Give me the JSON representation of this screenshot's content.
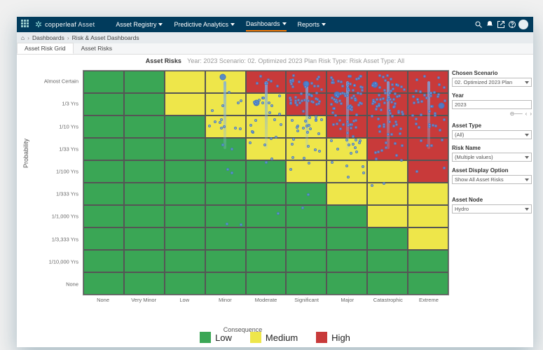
{
  "brand": {
    "name1": "copperleaf",
    "name2": "Asset"
  },
  "nav": {
    "items": [
      {
        "label": "Asset Registry"
      },
      {
        "label": "Predictive Analytics"
      },
      {
        "label": "Dashboards"
      },
      {
        "label": "Reports"
      }
    ],
    "active_index": 2
  },
  "breadcrumb": {
    "home": "⌂",
    "parts": [
      "Dashboards",
      "Risk & Asset Dashboards"
    ]
  },
  "subtabs": {
    "items": [
      "Asset Risk Grid",
      "Asset Risks"
    ],
    "active_index": 0
  },
  "chart_title": {
    "title": "Asset Risks",
    "meta": "Year: 2023   Scenario: 02. Optimized 2023 Plan   Risk Type: Risk   Asset Type: All"
  },
  "filters": {
    "scenario": {
      "label": "Chosen Scenario",
      "value": "02. Optimized 2023 Plan"
    },
    "year": {
      "label": "Year",
      "value": "2023"
    },
    "asset_type": {
      "label": "Asset Type",
      "value": "(All)"
    },
    "risk_name": {
      "label": "Risk Name",
      "value": "(Multiple values)"
    },
    "display": {
      "label": "Asset Display Option",
      "value": "Show All Asset Risks"
    },
    "node": {
      "label": "Asset Node",
      "value": "Hydro"
    }
  },
  "axes": {
    "xlabel": "Consequence",
    "ylabel": "Probability",
    "x_categories": [
      "None",
      "Very Minor",
      "Low",
      "Minor",
      "Moderate",
      "Significant",
      "Major",
      "Catastrophic",
      "Extreme"
    ],
    "y_categories": [
      "Almost Certain",
      "1/3 Yrs",
      "1/10 Yrs",
      "1/33 Yrs",
      "1/100 Yrs",
      "1/333 Yrs",
      "1/1,000 Yrs",
      "1/3,333 Yrs",
      "1/10,000 Yrs",
      "None"
    ]
  },
  "legend": {
    "low": "Low",
    "medium": "Medium",
    "high": "High"
  },
  "colors": {
    "low": "#3aa655",
    "medium": "#eee64a",
    "high": "#c83a3a",
    "navbg": "#013b5c",
    "accent": "#ff7a00"
  },
  "chart_data": {
    "type": "heatmap",
    "title": "Asset Risks",
    "xlabel": "Consequence",
    "ylabel": "Probability",
    "x_categories": [
      "None",
      "Very Minor",
      "Low",
      "Minor",
      "Moderate",
      "Significant",
      "Major",
      "Catastrophic",
      "Extreme"
    ],
    "y_categories_top_to_bottom": [
      "Almost Certain",
      "1/3 Yrs",
      "1/10 Yrs",
      "1/33 Yrs",
      "1/100 Yrs",
      "1/333 Yrs",
      "1/1,000 Yrs",
      "1/3,333 Yrs",
      "1/10,000 Yrs",
      "None"
    ],
    "risk_level_matrix_rows_top_to_bottom": [
      [
        "Low",
        "Low",
        "Medium",
        "Medium",
        "High",
        "High",
        "High",
        "High",
        "High"
      ],
      [
        "Low",
        "Low",
        "Medium",
        "Medium",
        "Medium",
        "High",
        "High",
        "High",
        "High"
      ],
      [
        "Low",
        "Low",
        "Low",
        "Medium",
        "Medium",
        "Medium",
        "High",
        "High",
        "High"
      ],
      [
        "Low",
        "Low",
        "Low",
        "Low",
        "Medium",
        "Medium",
        "Medium",
        "High",
        "High"
      ],
      [
        "Low",
        "Low",
        "Low",
        "Low",
        "Low",
        "Medium",
        "Medium",
        "Medium",
        "High"
      ],
      [
        "Low",
        "Low",
        "Low",
        "Low",
        "Low",
        "Low",
        "Medium",
        "Medium",
        "Medium"
      ],
      [
        "Low",
        "Low",
        "Low",
        "Low",
        "Low",
        "Low",
        "Low",
        "Medium",
        "Medium"
      ],
      [
        "Low",
        "Low",
        "Low",
        "Low",
        "Low",
        "Low",
        "Low",
        "Low",
        "Medium"
      ],
      [
        "Low",
        "Low",
        "Low",
        "Low",
        "Low",
        "Low",
        "Low",
        "Low",
        "Low"
      ],
      [
        "Low",
        "Low",
        "Low",
        "Low",
        "Low",
        "Low",
        "Low",
        "Low",
        "Low"
      ]
    ],
    "asset_points_approx": [
      {
        "x": "Minor",
        "y": "Almost Certain",
        "count": 4,
        "cluster_big": true
      },
      {
        "x": "Moderate",
        "y": "Almost Certain",
        "count": 12,
        "cluster_big": true
      },
      {
        "x": "Significant",
        "y": "Almost Certain",
        "count": 30,
        "cluster_big": true
      },
      {
        "x": "Major",
        "y": "Almost Certain",
        "count": 40,
        "cluster_big": true
      },
      {
        "x": "Catastrophic",
        "y": "Almost Certain",
        "count": 35,
        "cluster_big": true
      },
      {
        "x": "Extreme",
        "y": "Almost Certain",
        "count": 20,
        "cluster_big": true
      },
      {
        "x": "Minor",
        "y": "1/3 Yrs",
        "count": 6
      },
      {
        "x": "Moderate",
        "y": "1/3 Yrs",
        "count": 10
      },
      {
        "x": "Significant",
        "y": "1/3 Yrs",
        "count": 22
      },
      {
        "x": "Major",
        "y": "1/3 Yrs",
        "count": 28
      },
      {
        "x": "Catastrophic",
        "y": "1/3 Yrs",
        "count": 24
      },
      {
        "x": "Extreme",
        "y": "1/3 Yrs",
        "count": 14
      },
      {
        "x": "Minor",
        "y": "1/10 Yrs",
        "count": 5
      },
      {
        "x": "Moderate",
        "y": "1/10 Yrs",
        "count": 6
      },
      {
        "x": "Significant",
        "y": "1/10 Yrs",
        "count": 10
      },
      {
        "x": "Major",
        "y": "1/10 Yrs",
        "count": 14
      },
      {
        "x": "Catastrophic",
        "y": "1/10 Yrs",
        "count": 12
      },
      {
        "x": "Extreme",
        "y": "1/10 Yrs",
        "count": 8
      },
      {
        "x": "Minor",
        "y": "1/33 Yrs",
        "count": 3
      },
      {
        "x": "Moderate",
        "y": "1/33 Yrs",
        "count": 3
      },
      {
        "x": "Significant",
        "y": "1/33 Yrs",
        "count": 5
      },
      {
        "x": "Major",
        "y": "1/33 Yrs",
        "count": 7
      },
      {
        "x": "Catastrophic",
        "y": "1/33 Yrs",
        "count": 6
      },
      {
        "x": "Extreme",
        "y": "1/33 Yrs",
        "count": 3
      },
      {
        "x": "Major",
        "y": "1/100 Yrs",
        "count": 3
      },
      {
        "x": "Catastrophic",
        "y": "1/100 Yrs",
        "count": 2
      },
      {
        "x": "Significant",
        "y": "1/333 Yrs",
        "count": 2
      },
      {
        "x": "Minor",
        "y": "1/1,000 Yrs",
        "count": 2
      },
      {
        "x": "Moderate",
        "y": "1/1,000 Yrs",
        "count": 1
      }
    ]
  }
}
